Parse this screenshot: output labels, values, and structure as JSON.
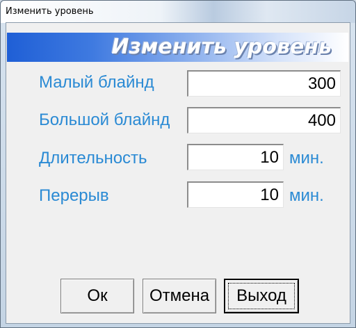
{
  "window": {
    "title": "Изменить уровень"
  },
  "banner": {
    "title": "Изменить уровень"
  },
  "form": {
    "small_blind": {
      "label": "Малый блайнд",
      "value": "300"
    },
    "big_blind": {
      "label": "Большой блайнд",
      "value": "400"
    },
    "duration": {
      "label": "Длительность",
      "value": "10",
      "unit": "мин."
    },
    "break": {
      "label": "Перерыв",
      "value": "10",
      "unit": "мин."
    }
  },
  "buttons": {
    "ok": "Ок",
    "cancel": "Отмена",
    "exit": "Выход"
  },
  "colors": {
    "label": "#2a8ad4",
    "banner_start": "#1f5fd6",
    "banner_end": "#ffffff"
  }
}
